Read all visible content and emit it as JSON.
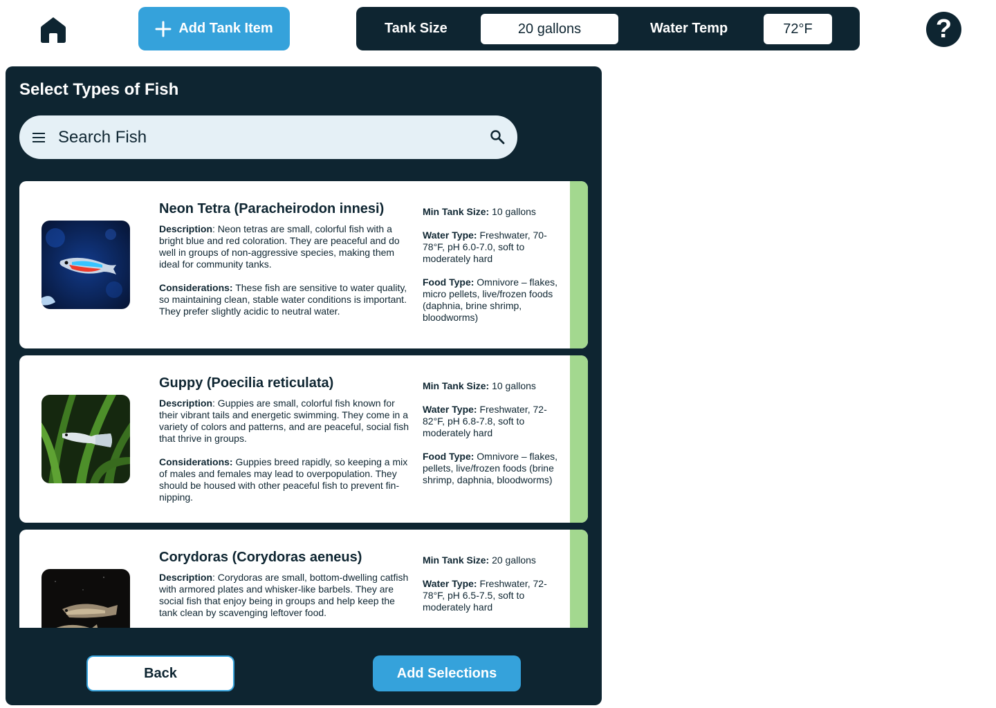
{
  "header": {
    "add_tank_label": "Add Tank Item",
    "tank_size_label": "Tank Size",
    "tank_size_value": "20 gallons",
    "water_temp_label": "Water Temp",
    "water_temp_value": "72°F",
    "help_symbol": "?"
  },
  "panel": {
    "title": "Select Types of Fish",
    "search_placeholder": "Search Fish"
  },
  "labels": {
    "description": "Description",
    "considerations": "Considerations:",
    "min_tank": "Min Tank Size:",
    "water_type": "Water Type:",
    "food_type": "Food Type:"
  },
  "fish": [
    {
      "name": "Neon Tetra (Paracheirodon innesi)",
      "description": ": Neon tetras are small, colorful fish with a bright blue and red coloration. They are peaceful and do well in groups of non-aggressive species, making them ideal for community tanks.",
      "considerations": " These fish are sensitive to water quality, so maintaining clean, stable water conditions is important. They prefer slightly acidic to neutral water.",
      "min_tank": " 10 gallons",
      "water_type": " Freshwater, 70-78°F, pH 6.0-7.0, soft to moderately hard",
      "food_type": " Omnivore – flakes, micro pellets, live/frozen foods (daphnia, brine shrimp, bloodworms)"
    },
    {
      "name": "Guppy (Poecilia reticulata)",
      "description": ": Guppies are small, colorful fish known for their vibrant tails and energetic swimming. They come in a variety of colors and patterns, and are peaceful, social fish that thrive in groups.",
      "considerations": " Guppies breed rapidly, so keeping a mix of males and females may lead to overpopulation. They should be housed with other peaceful fish to prevent fin-nipping.",
      "min_tank": " 10 gallons",
      "water_type": " Freshwater, 72-82°F, pH 6.8-7.8, soft to moderately hard",
      "food_type": " Omnivore – flakes, pellets, live/frozen foods (brine shrimp, daphnia, bloodworms)"
    },
    {
      "name": "Corydoras (Corydoras aeneus)",
      "description": ": Corydoras are small, bottom-dwelling catfish with armored plates and whisker-like barbels. They are social fish that enjoy being in groups and help keep the tank clean by scavenging leftover food.",
      "considerations": "",
      "min_tank": " 20 gallons",
      "water_type": " Freshwater, 72-78°F, pH 6.5-7.5, soft to moderately hard",
      "food_type": ""
    }
  ],
  "footer": {
    "back_label": "Back",
    "add_selections_label": "Add Selections"
  },
  "colors": {
    "dark": "#0e2531",
    "accent": "#35a2db",
    "selected_stripe": "#a3d88f",
    "search_bg": "#e5f0f6"
  }
}
